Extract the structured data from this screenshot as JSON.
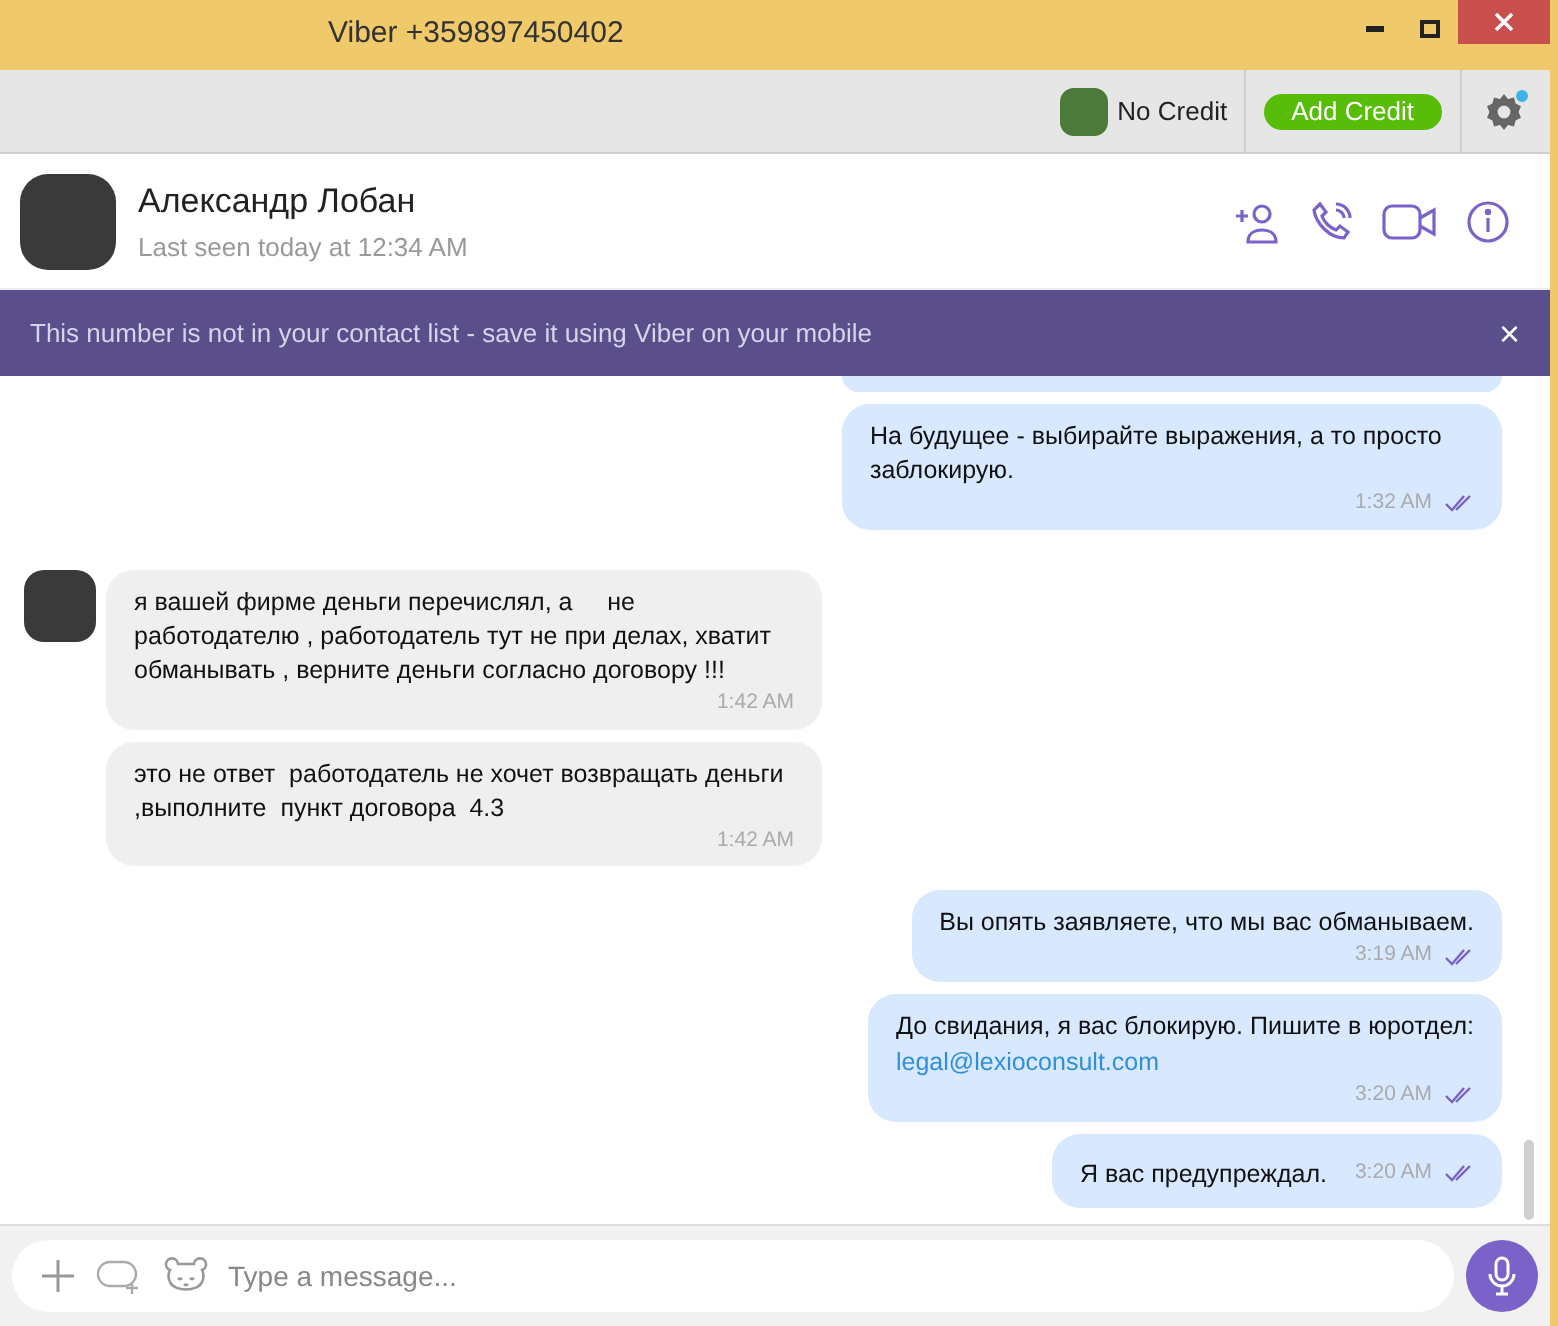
{
  "window": {
    "title": "Viber +359897450402"
  },
  "toolbar": {
    "credit_label": "No Credit",
    "add_credit_button": "Add Credit",
    "settings_notification": true
  },
  "contact": {
    "name": "Александр Лобан",
    "status": "Last seen today at 12:34 AM"
  },
  "banner": {
    "text": "This number is not in your contact list - save it using Viber on your mobile",
    "close": "×"
  },
  "messages": [
    {
      "kind": "out",
      "partial": true
    },
    {
      "kind": "out",
      "text": "На будущее - выбирайте выражения, а то просто заблокирую.",
      "time": "1:32 AM",
      "read": true
    },
    {
      "kind": "in",
      "text": "я вашей фирме деньги перечислял, а     не работодателю , работодатель тут не при делах, хватит обманывать , верните деньги согласно договору !!!",
      "time": "1:42 AM",
      "avatar": true
    },
    {
      "kind": "in",
      "text": "это не ответ  работодатель не хочет возвращать деньги ,выполните  пункт договора  4.3",
      "time": "1:42 AM",
      "avatar": false
    },
    {
      "kind": "out",
      "text": "Вы опять заявляете, что мы вас обманываем.",
      "time": "3:19 AM",
      "read": true
    },
    {
      "kind": "out",
      "text": "До свидания, я вас блокирую. Пишите в юротдел:",
      "link": "legal@lexioconsult.com",
      "time": "3:20 AM",
      "read": true
    },
    {
      "kind": "out",
      "text": "Я вас предупреждал.",
      "time": "3:20 AM",
      "read": true,
      "inline_time": true
    }
  ],
  "composer": {
    "placeholder": "Type a message..."
  }
}
